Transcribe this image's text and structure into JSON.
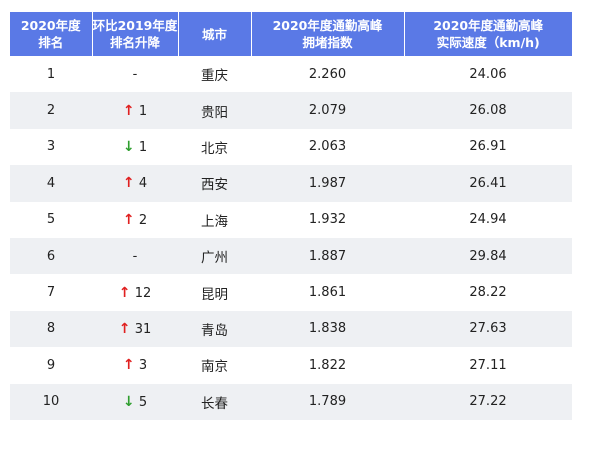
{
  "colors": {
    "header_bg": "#5a79e6",
    "stripe_bg": "#eef0f3",
    "up_arrow": "#e02020",
    "down_arrow": "#2e9e2e"
  },
  "header": {
    "rank": [
      "2020年度",
      "排名"
    ],
    "change": [
      "环比2019年度",
      "排名升降"
    ],
    "city": [
      "城市"
    ],
    "index": [
      "2020年度通勤高峰",
      "拥堵指数"
    ],
    "speed": [
      "2020年度通勤高峰",
      "实际速度（km/h)"
    ]
  },
  "arrows": {
    "up": "↑",
    "down": "↓"
  },
  "rows": [
    {
      "rank": "1",
      "direction": "none",
      "change": "-",
      "city": "重庆",
      "index": "2.260",
      "speed": "24.06"
    },
    {
      "rank": "2",
      "direction": "up",
      "change": "1",
      "city": "贵阳",
      "index": "2.079",
      "speed": "26.08"
    },
    {
      "rank": "3",
      "direction": "down",
      "change": "1",
      "city": "北京",
      "index": "2.063",
      "speed": "26.91"
    },
    {
      "rank": "4",
      "direction": "up",
      "change": "4",
      "city": "西安",
      "index": "1.987",
      "speed": "26.41"
    },
    {
      "rank": "5",
      "direction": "up",
      "change": "2",
      "city": "上海",
      "index": "1.932",
      "speed": "24.94"
    },
    {
      "rank": "6",
      "direction": "none",
      "change": "-",
      "city": "广州",
      "index": "1.887",
      "speed": "29.84"
    },
    {
      "rank": "7",
      "direction": "up",
      "change": "12",
      "city": "昆明",
      "index": "1.861",
      "speed": "28.22"
    },
    {
      "rank": "8",
      "direction": "up",
      "change": "31",
      "city": "青岛",
      "index": "1.838",
      "speed": "27.63"
    },
    {
      "rank": "9",
      "direction": "up",
      "change": "3",
      "city": "南京",
      "index": "1.822",
      "speed": "27.11"
    },
    {
      "rank": "10",
      "direction": "down",
      "change": "5",
      "city": "长春",
      "index": "1.789",
      "speed": "27.22"
    }
  ]
}
